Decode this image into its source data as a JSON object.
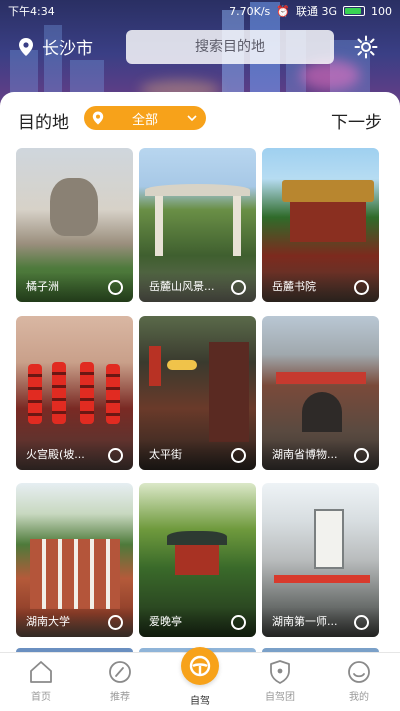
{
  "status_bar": {
    "time": "下午4:34",
    "net_speed": "7.70K/s",
    "carrier": "联通 3G",
    "battery": "100"
  },
  "header": {
    "city": "长沙市",
    "search_placeholder": "搜索目的地"
  },
  "filter": {
    "label": "目的地",
    "region_selected": "全部",
    "next_label": "下一步"
  },
  "colors": {
    "accent": "#f7a21a",
    "text": "#222222",
    "tab_inactive": "#9a9a9a"
  },
  "destinations": [
    {
      "name": "橘子洲"
    },
    {
      "name": "岳麓山风景..."
    },
    {
      "name": "岳麓书院"
    },
    {
      "name": "火宫殿(坡..."
    },
    {
      "name": "太平街"
    },
    {
      "name": "湖南省博物..."
    },
    {
      "name": "湖南大学"
    },
    {
      "name": "爱晚亭"
    },
    {
      "name": "湖南第一师..."
    }
  ],
  "tabs": [
    {
      "label": "首页",
      "icon": "home-icon"
    },
    {
      "label": "推荐",
      "icon": "compass-icon"
    },
    {
      "label": "自驾",
      "icon": "steering-wheel-icon"
    },
    {
      "label": "自驾团",
      "icon": "shield-icon"
    },
    {
      "label": "我的",
      "icon": "smile-face-icon"
    }
  ]
}
